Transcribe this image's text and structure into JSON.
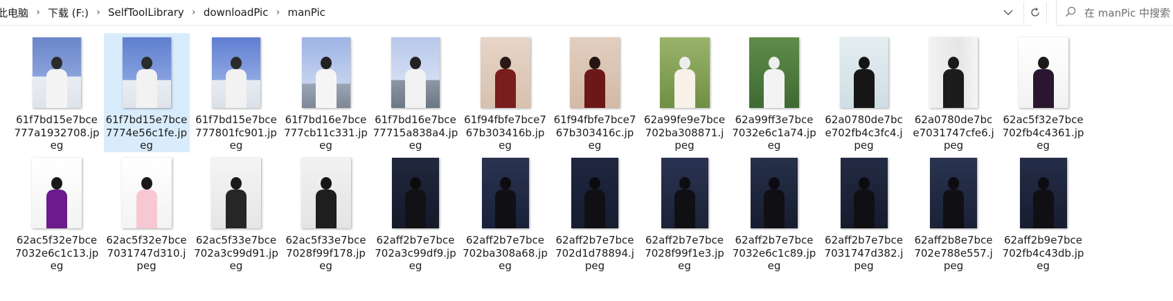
{
  "breadcrumb": {
    "items": [
      "此电脑",
      "下载 (F:)",
      "SelfToolLibrary",
      "downloadPic",
      "manPic"
    ],
    "separator": "›"
  },
  "search": {
    "placeholder": "在 manPic 中搜索"
  },
  "files": [
    {
      "name": "61f7bd15e7bce777a1932708.jpeg",
      "line1": "61f7bd15e7bce",
      "line2": "777a1932708.jp",
      "line3": "eg"
    },
    {
      "name": "61f7bd15e7bce7774e56c1fe.jpeg",
      "line1": "61f7bd15e7bce",
      "line2": "7774e56c1fe.jp",
      "line3": "eg"
    },
    {
      "name": "61f7bd15e7bce777801fc901.jpeg",
      "line1": "61f7bd15e7bce",
      "line2": "777801fc901.jp",
      "line3": "eg"
    },
    {
      "name": "61f7bd16e7bce777cb11c331.jpeg",
      "line1": "61f7bd16e7bce",
      "line2": "777cb11c331.jp",
      "line3": "eg"
    },
    {
      "name": "61f7bd16e7bce77715a838a4.jpeg",
      "line1": "61f7bd16e7bce",
      "line2": "77715a838a4.jp",
      "line3": "eg"
    },
    {
      "name": "61f94fbfe7bce767b303416b.jpeg",
      "line1": "61f94fbfe7bce7",
      "line2": "67b303416b.jp",
      "line3": "eg"
    },
    {
      "name": "61f94fbfe7bce767b303416c.jpeg",
      "line1": "61f94fbfe7bce7",
      "line2": "67b303416c.jp",
      "line3": "eg"
    },
    {
      "name": "62a99fe9e7bce702ba308871.jpeg",
      "line1": "62a99fe9e7bce",
      "line2": "702ba308871.j",
      "line3": "peg"
    },
    {
      "name": "62a99ff3e7bce7032e6c1a74.jpeg",
      "line1": "62a99ff3e7bce",
      "line2": "7032e6c1a74.jp",
      "line3": "eg"
    },
    {
      "name": "62a0780de7bce702fb4c3fc4.jpeg",
      "line1": "62a0780de7bc",
      "line2": "e702fb4c3fc4.j",
      "line3": "peg"
    },
    {
      "name": "62a0780de7bce7031747cfe6.jpeg",
      "line1": "62a0780de7bc",
      "line2": "e7031747cfe6.j",
      "line3": "peg"
    },
    {
      "name": "62ac5f32e7bce702fb4c4361.jpeg",
      "line1": "62ac5f32e7bce",
      "line2": "702fb4c4361.jp",
      "line3": "eg"
    },
    {
      "name": "62ac5f32e7bce7032e6c1c13.jpeg",
      "line1": "62ac5f32e7bce",
      "line2": "7032e6c1c13.jp",
      "line3": "eg"
    },
    {
      "name": "62ac5f32e7bce7031747d310.jpeg",
      "line1": "62ac5f32e7bce",
      "line2": "7031747d310.j",
      "line3": "peg"
    },
    {
      "name": "62ac5f33e7bce702a3c99d91.jpeg",
      "line1": "62ac5f33e7bce",
      "line2": "702a3c99d91.jp",
      "line3": "eg"
    },
    {
      "name": "62ac5f33e7bce7028f99f178.jpeg",
      "line1": "62ac5f33e7bce",
      "line2": "7028f99f178.jp",
      "line3": "eg"
    },
    {
      "name": "62aff2b7e7bce702a3c99df9.jpeg",
      "line1": "62aff2b7e7bce",
      "line2": "702a3c99df9.jp",
      "line3": "eg"
    },
    {
      "name": "62aff2b7e7bce702ba308a68.jpeg",
      "line1": "62aff2b7e7bce",
      "line2": "702ba308a68.jp",
      "line3": "eg"
    },
    {
      "name": "62aff2b7e7bce702d1d78894.jpeg",
      "line1": "62aff2b7e7bce",
      "line2": "702d1d78894.j",
      "line3": "peg"
    },
    {
      "name": "62aff2b7e7bce7028f99f1e3.jpeg",
      "line1": "62aff2b7e7bce",
      "line2": "7028f99f1e3.jp",
      "line3": "eg"
    },
    {
      "name": "62aff2b7e7bce7032e6c1c89.jpeg",
      "line1": "62aff2b7e7bce",
      "line2": "7032e6c1c89.jp",
      "line3": "eg"
    },
    {
      "name": "62aff2b7e7bce7031747d382.jpeg",
      "line1": "62aff2b7e7bce",
      "line2": "7031747d382.j",
      "line3": "peg"
    },
    {
      "name": "62aff2b8e7bce702e788e557.jpeg",
      "line1": "62aff2b8e7bce",
      "line2": "702e788e557.j",
      "line3": "peg"
    },
    {
      "name": "62aff2b9e7bce702fb4c43db.jpeg",
      "line1": "62aff2b9e7bce",
      "line2": "702fb4c43db.jp",
      "line3": "eg"
    }
  ],
  "selected_index": 1,
  "colors": {
    "selection": "#d9ecfb",
    "border": "#e5e5e5"
  },
  "icons": {
    "dropdown": "chevron-down-icon",
    "refresh": "refresh-icon",
    "search": "search-icon",
    "separator": "chevron-right-icon"
  }
}
